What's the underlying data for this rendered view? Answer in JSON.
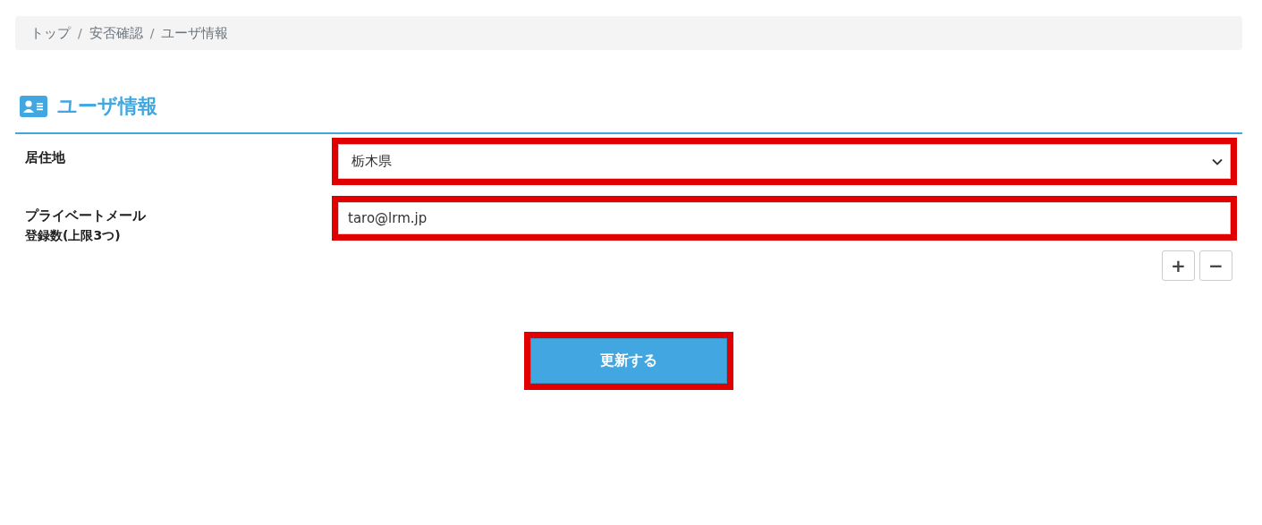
{
  "breadcrumb": [
    {
      "label": "トップ"
    },
    {
      "label": "安否確認"
    },
    {
      "label": "ユーザ情報"
    }
  ],
  "breadcrumb_separator": "/",
  "heading": "ユーザ情報",
  "fields": [
    {
      "kind": "select",
      "label": "居住地",
      "value": "栃木県",
      "highlighted": true
    },
    {
      "kind": "text",
      "label": "プライベートメール",
      "sublabel": "登録数(上限3つ)",
      "value": "taro@lrm.jp",
      "highlighted": true
    }
  ],
  "count_buttons": [
    "+",
    "−"
  ],
  "submit": {
    "label": "更新する",
    "highlighted": true
  }
}
